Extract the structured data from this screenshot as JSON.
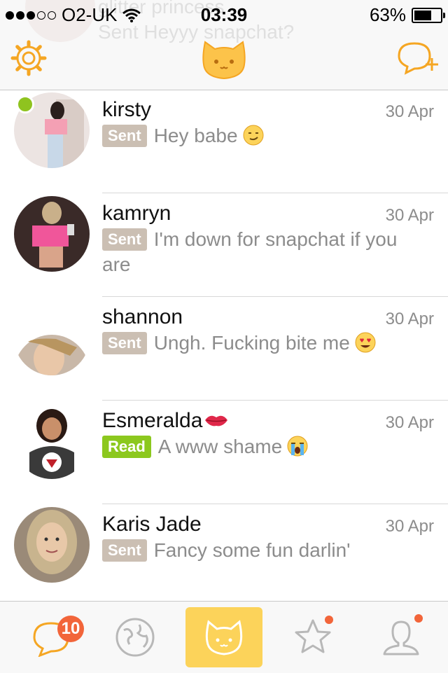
{
  "status_bar": {
    "carrier": "O2-UK",
    "time": "03:39",
    "battery": "63%",
    "signal_bars_filled": 3,
    "signal_bars_total": 5
  },
  "header": {
    "ghost_name": "glitter princess",
    "ghost_badge": "Sent",
    "ghost_message": "Heyyy snapchat?",
    "accent_color": "#f5a623"
  },
  "conversations": [
    {
      "name": "kirsty",
      "date": "30 Apr",
      "status": "Sent",
      "message": "Hey babe",
      "emoji": "smirk-face",
      "online": true
    },
    {
      "name": "kamryn",
      "date": "30 Apr",
      "status": "Sent",
      "message": "I'm down for snapchat if you are",
      "emoji": "",
      "online": false
    },
    {
      "name": "shannon",
      "date": "30 Apr",
      "status": "Sent",
      "message": "Ungh. Fucking bite me",
      "emoji": "heart-eyes-face",
      "online": false
    },
    {
      "name": "Esmeralda",
      "date": "30 Apr",
      "status": "Read",
      "message": "A www shame",
      "emoji": "crying-face",
      "name_emoji": "kiss-lips",
      "online": false
    },
    {
      "name": "Karis Jade",
      "date": "30 Apr",
      "status": "Sent",
      "message": "Fancy some fun darlin'",
      "emoji": "",
      "online": false
    }
  ],
  "tabbar": {
    "chats_count": "10",
    "tabs": [
      "chats",
      "explore",
      "home",
      "favorites",
      "profile"
    ],
    "active": "home",
    "active_color": "#fcd35a",
    "badge_color": "#f2653a"
  }
}
